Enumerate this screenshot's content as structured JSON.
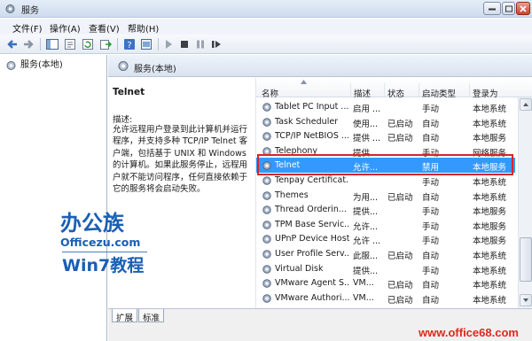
{
  "window": {
    "title": "服务"
  },
  "menu": [
    "文件(F)",
    "操作(A)",
    "查看(V)",
    "帮助(H)"
  ],
  "toolbar_icons": [
    "back-icon",
    "forward-icon",
    "console-tree-icon",
    "properties-icon",
    "refresh-icon",
    "export-icon",
    "help-icon",
    "mmc-icon",
    "play-icon",
    "stop-icon",
    "pause-icon",
    "restart-icon"
  ],
  "tree": {
    "root_label": "服务(本地)"
  },
  "pane_header": {
    "label": "服务(本地)"
  },
  "details": {
    "service_name": "Telnet",
    "desc_label": "描述:",
    "description": "允许远程用户登录到此计算机并运行程序，并支持多种 TCP/IP Telnet 客户端，包括基于 UNIX 和 Windows 的计算机。如果此服务停止，远程用户就不能访问程序，任何直接依赖于它的服务将会启动失败。"
  },
  "columns": [
    "名称",
    "描述",
    "状态",
    "启动类型",
    "登录为"
  ],
  "services": [
    {
      "name": "Tablet PC Input ...",
      "desc": "启用 ...",
      "status": "",
      "startup": "手动",
      "logon": "本地系统"
    },
    {
      "name": "Task Scheduler",
      "desc": "使用...",
      "status": "已启动",
      "startup": "自动",
      "logon": "本地系统"
    },
    {
      "name": "TCP/IP NetBIOS ...",
      "desc": "提供 ...",
      "status": "已启动",
      "startup": "自动",
      "logon": "本地服务"
    },
    {
      "name": "Telephony",
      "desc": "提供...",
      "status": "",
      "startup": "手动",
      "logon": "网络服务"
    },
    {
      "name": "Telnet",
      "desc": "允许...",
      "status": "",
      "startup": "禁用",
      "logon": "本地服务"
    },
    {
      "name": "Tenpay Certificat...",
      "desc": "",
      "status": "",
      "startup": "手动",
      "logon": "本地系统"
    },
    {
      "name": "Themes",
      "desc": "为用...",
      "status": "已启动",
      "startup": "自动",
      "logon": "本地系统"
    },
    {
      "name": "Thread Orderin...",
      "desc": "提供...",
      "status": "",
      "startup": "手动",
      "logon": "本地服务"
    },
    {
      "name": "TPM Base Servic...",
      "desc": "允许...",
      "status": "",
      "startup": "手动",
      "logon": "本地服务"
    },
    {
      "name": "UPnP Device Host",
      "desc": "允许 ...",
      "status": "",
      "startup": "手动",
      "logon": "本地服务"
    },
    {
      "name": "User Profile Serv...",
      "desc": "此服...",
      "status": "已启动",
      "startup": "自动",
      "logon": "本地系统"
    },
    {
      "name": "Virtual Disk",
      "desc": "提供...",
      "status": "",
      "startup": "手动",
      "logon": "本地系统"
    },
    {
      "name": "VMware Agent S...",
      "desc": "VM...",
      "status": "已启动",
      "startup": "自动",
      "logon": "本地系统"
    },
    {
      "name": "VMware Authori...",
      "desc": "VM...",
      "status": "已启动",
      "startup": "自动",
      "logon": "本地系统"
    }
  ],
  "selected_index": 4,
  "tabs": [
    "扩展",
    "标准"
  ],
  "watermark": {
    "logo_line1": "办公族",
    "logo_line2": "Officezu.com",
    "logo_line3": "Win7教程",
    "site": "www.office68.com",
    "color": "#e0281e"
  },
  "colors": {
    "selection": "#3399ff",
    "highlight_border": "#d9232a",
    "logo_blue": "#1a5fb4"
  }
}
